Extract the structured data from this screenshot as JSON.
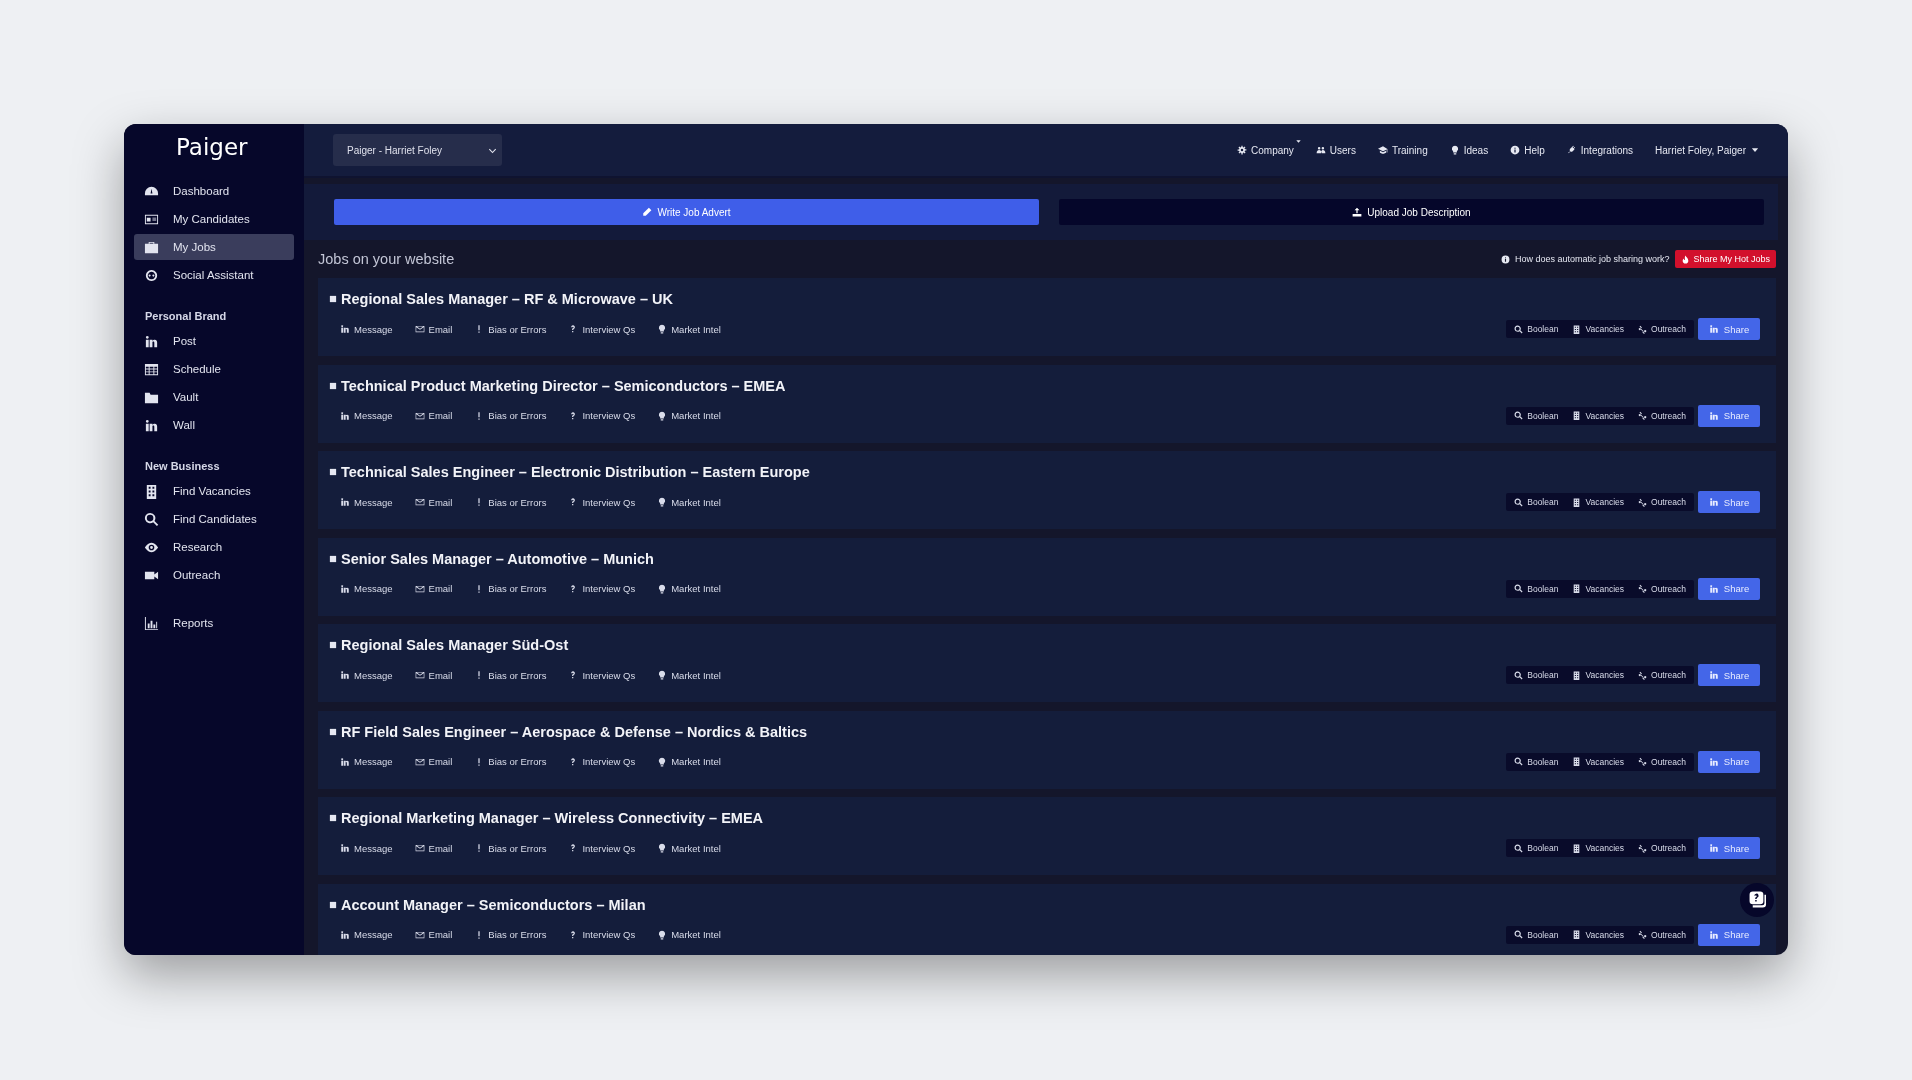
{
  "sidebar": {
    "logo": "Paiger",
    "main_items": [
      {
        "label": "Dashboard",
        "selected": false
      },
      {
        "label": "My Candidates",
        "selected": false
      },
      {
        "label": "My Jobs",
        "selected": true
      },
      {
        "label": "Social Assistant",
        "selected": false
      }
    ],
    "sections": [
      {
        "heading": "Personal Brand",
        "items": [
          {
            "label": "Post",
            "selected": false
          },
          {
            "label": "Schedule",
            "selected": false
          },
          {
            "label": "Vault",
            "selected": false
          },
          {
            "label": "Wall",
            "selected": false
          }
        ]
      },
      {
        "heading": "New Business",
        "items": [
          {
            "label": "Find Vacancies",
            "selected": false
          },
          {
            "label": "Find Candidates",
            "selected": false
          },
          {
            "label": "Research",
            "selected": false
          },
          {
            "label": "Outreach",
            "selected": false
          }
        ]
      }
    ],
    "bottom_items": [
      {
        "label": "Reports",
        "selected": false
      }
    ]
  },
  "topbar": {
    "account_select": {
      "value": "Paiger - Harriet Foley"
    },
    "nav": [
      "Company",
      "Users",
      "Training",
      "Ideas",
      "Help",
      "Integrations"
    ],
    "user_menu": "Harriet Foley, Paiger"
  },
  "actions": {
    "write": "Write Job Advert",
    "upload": "Upload Job Description"
  },
  "jobs_header": {
    "title": "Jobs on your website",
    "help": "How does automatic job sharing work?",
    "share_hot": "Share My Hot Jobs"
  },
  "jobs": [
    {
      "title": "Regional Sales Manager – RF & Microwave – UK",
      "actions": [
        "Message",
        "Email",
        "Bias or Errors",
        "Interview Qs",
        "Market Intel"
      ],
      "tools": [
        "Boolean",
        "Vacancies",
        "Outreach"
      ],
      "share": "Share"
    },
    {
      "title": "Technical Product Marketing Director – Semiconductors – EMEA",
      "actions": [
        "Message",
        "Email",
        "Bias or Errors",
        "Interview Qs",
        "Market Intel"
      ],
      "tools": [
        "Boolean",
        "Vacancies",
        "Outreach"
      ],
      "share": "Share"
    },
    {
      "title": "Technical Sales Engineer – Electronic Distribution – Eastern Europe",
      "actions": [
        "Message",
        "Email",
        "Bias or Errors",
        "Interview Qs",
        "Market Intel"
      ],
      "tools": [
        "Boolean",
        "Vacancies",
        "Outreach"
      ],
      "share": "Share"
    },
    {
      "title": "Senior Sales Manager – Automotive – Munich",
      "actions": [
        "Message",
        "Email",
        "Bias or Errors",
        "Interview Qs",
        "Market Intel"
      ],
      "tools": [
        "Boolean",
        "Vacancies",
        "Outreach"
      ],
      "share": "Share"
    },
    {
      "title": "Regional Sales Manager Süd-Ost",
      "actions": [
        "Message",
        "Email",
        "Bias or Errors",
        "Interview Qs",
        "Market Intel"
      ],
      "tools": [
        "Boolean",
        "Vacancies",
        "Outreach"
      ],
      "share": "Share"
    },
    {
      "title": "RF Field Sales Engineer – Aerospace & Defense – Nordics & Baltics",
      "actions": [
        "Message",
        "Email",
        "Bias or Errors",
        "Interview Qs",
        "Market Intel"
      ],
      "tools": [
        "Boolean",
        "Vacancies",
        "Outreach"
      ],
      "share": "Share"
    },
    {
      "title": "Regional Marketing Manager – Wireless Connectivity – EMEA",
      "actions": [
        "Message",
        "Email",
        "Bias or Errors",
        "Interview Qs",
        "Market Intel"
      ],
      "tools": [
        "Boolean",
        "Vacancies",
        "Outreach"
      ],
      "share": "Share"
    },
    {
      "title": "Account Manager – Semiconductors – Milan",
      "actions": [
        "Message",
        "Email",
        "Bias or Errors",
        "Interview Qs",
        "Market Intel"
      ],
      "tools": [
        "Boolean",
        "Vacancies",
        "Outreach"
      ],
      "share": "Share"
    }
  ]
}
